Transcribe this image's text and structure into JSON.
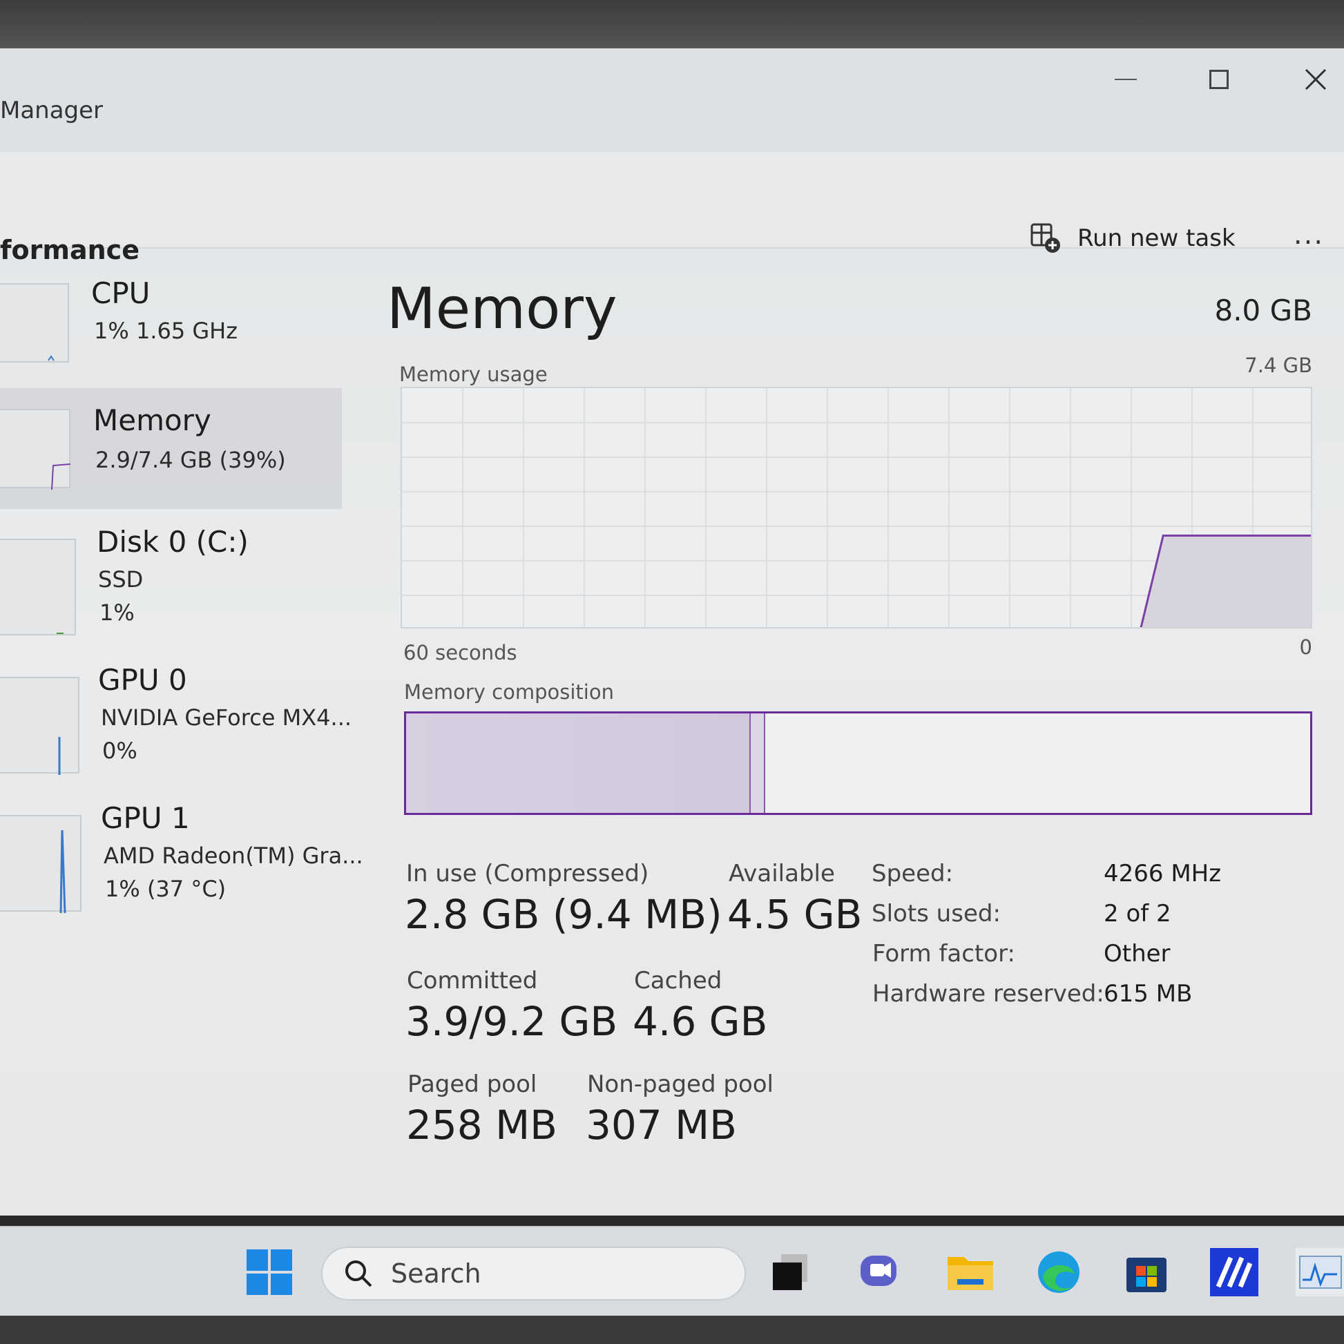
{
  "window": {
    "title": "Manager",
    "minimize_label": "Minimize",
    "maximize_label": "Maximize",
    "close_label": "Close"
  },
  "toolbar": {
    "page": "formance",
    "run_new_task": "Run new task",
    "more": "..."
  },
  "sidebar": {
    "items": [
      {
        "name": "CPU",
        "line1": "1%  1.65 GHz"
      },
      {
        "name": "Memory",
        "line1": "2.9/7.4 GB (39%)"
      },
      {
        "name": "Disk 0 (C:)",
        "line1": "SSD",
        "line2": "1%"
      },
      {
        "name": "GPU 0",
        "line1": "NVIDIA GeForce MX4...",
        "line2": "0%"
      },
      {
        "name": "GPU 1",
        "line1": "AMD Radeon(TM) Gra...",
        "line2": "1%  (37 °C)"
      }
    ]
  },
  "main": {
    "title": "Memory",
    "total": "8.0 GB",
    "usage_label": "Memory usage",
    "usage_max": "7.4 GB",
    "time_left": "60 seconds",
    "time_right": "0",
    "composition_label": "Memory composition",
    "in_use_fraction": 0.38,
    "modified_fraction": 0.017,
    "usage_level_fraction": 0.39
  },
  "stats": {
    "in_use_label": "In use (Compressed)",
    "in_use_value": "2.8 GB (9.4 MB)",
    "available_label": "Available",
    "available_value": "4.5 GB",
    "committed_label": "Committed",
    "committed_value": "3.9/9.2 GB",
    "cached_label": "Cached",
    "cached_value": "4.6 GB",
    "paged_label": "Paged pool",
    "paged_value": "258 MB",
    "nonpaged_label": "Non-paged pool",
    "nonpaged_value": "307 MB"
  },
  "specs": {
    "speed_label": "Speed:",
    "speed_value": "4266 MHz",
    "slots_label": "Slots used:",
    "slots_value": "2 of 2",
    "form_label": "Form factor:",
    "form_value": "Other",
    "hw_label": "Hardware reserved:",
    "hw_value": "615 MB"
  },
  "taskbar": {
    "search_placeholder": "Search"
  },
  "colors": {
    "memory_accent": "#7b3fa6",
    "memory_fill": "#d8d0e2"
  }
}
